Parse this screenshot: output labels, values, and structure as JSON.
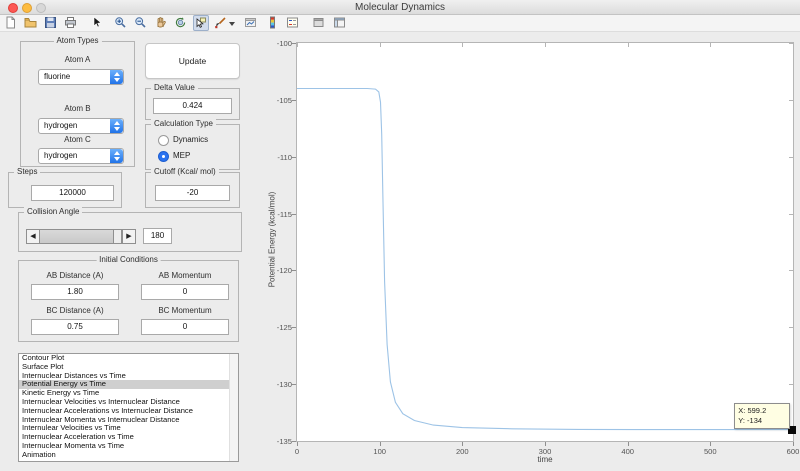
{
  "window": {
    "title": "Molecular Dynamics"
  },
  "toolbar": {
    "icons": [
      "new-document",
      "open-file",
      "save",
      "print",
      "edit-plot-pointer",
      "zoom-in",
      "zoom-out",
      "pan-hand",
      "rotate-3d",
      "data-cursor",
      "brush",
      "link-plot",
      "insert-colorbar",
      "insert-legend",
      "hide-plot-tools",
      "show-plot-tools"
    ],
    "active_tool": "data-cursor"
  },
  "panels": {
    "atom_types": {
      "title": "Atom Types",
      "atom_a_label": "Atom A",
      "atom_a_value": "fluorine",
      "atom_b_label": "Atom B",
      "atom_b_value": "hydrogen",
      "atom_c_label": "Atom C",
      "atom_c_value": "hydrogen"
    },
    "update_button": "Update",
    "delta": {
      "title": "Delta Value",
      "value": "0.424"
    },
    "calculation": {
      "title": "Calculation Type",
      "options": [
        {
          "label": "Dynamics",
          "selected": false
        },
        {
          "label": "MEP",
          "selected": true
        }
      ]
    },
    "steps": {
      "title": "Steps",
      "value": "120000"
    },
    "cutoff": {
      "title": "Cutoff (Kcal/ mol)",
      "value": "-20"
    },
    "collision": {
      "title": "Collision Angle",
      "value": "180"
    },
    "initial": {
      "title": "Initial Conditions",
      "fields": [
        {
          "label": "AB Distance (A)",
          "value": "1.80"
        },
        {
          "label": "AB Momentum",
          "value": "0"
        },
        {
          "label": "BC Distance (A)",
          "value": "0.75"
        },
        {
          "label": "BC Momentum",
          "value": "0"
        }
      ]
    }
  },
  "plot_list": {
    "items": [
      "Contour Plot",
      "Surface Plot",
      "Internuclear Distances vs Time",
      "Potential Energy vs Time",
      "Kinetic Energy vs Time",
      "Internuclear Velocities vs Internuclear Distance",
      "Internuclear Accelerations vs Internuclear Distance",
      "Internuclear Momenta vs Internuclear Distance",
      "Internulear Velocities vs Time",
      "Internuclear Acceleration vs Time",
      "Internuclear Momenta vs Time",
      "Animation"
    ],
    "selected_index": 3
  },
  "datatip": {
    "x_label": "X: 599.2",
    "y_label": "Y: -134"
  },
  "chart_data": {
    "type": "line",
    "title": "",
    "xlabel": "time",
    "ylabel": "Potential Energy (kcal/mol)",
    "xlim": [
      0,
      600
    ],
    "ylim": [
      -135,
      -100
    ],
    "xticks": [
      0,
      100,
      200,
      300,
      400,
      500,
      600
    ],
    "yticks": [
      -100,
      -105,
      -110,
      -115,
      -120,
      -125,
      -130,
      -135
    ],
    "grid": false,
    "legend": false,
    "series": [
      {
        "name": "Potential Energy",
        "color": "#9dc3e6",
        "x": [
          0,
          85,
          95,
          99,
          101,
          102.5,
          104,
          106,
          109,
          113,
          119,
          128,
          142,
          165,
          200,
          260,
          340,
          430,
          520,
          599.2
        ],
        "y": [
          -104,
          -104,
          -104.05,
          -104.3,
          -105.2,
          -108,
          -114,
          -121,
          -126.5,
          -129.8,
          -131.6,
          -132.6,
          -133.2,
          -133.6,
          -133.82,
          -133.93,
          -133.98,
          -134,
          -134,
          -134
        ]
      }
    ],
    "datatip_point": {
      "x": 599.2,
      "y": -134
    }
  }
}
